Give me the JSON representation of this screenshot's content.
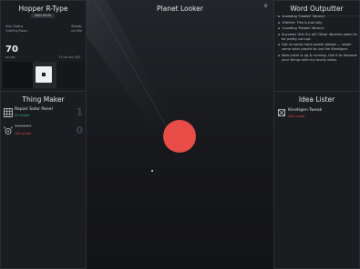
{
  "hopper": {
    "title": "Hopper R-Type",
    "subtitle": "0001.00.00",
    "rows": [
      {
        "label": "Ship Status",
        "value": "Steady"
      },
      {
        "label": "Orbiting Moon",
        "value": "no title"
      }
    ],
    "big_value": "70",
    "big_sub": "scrubs",
    "big_right": "13 ton ton 000"
  },
  "thing_maker": {
    "title": "Thing Maker",
    "items": [
      {
        "name": "Repair Solar Panel",
        "cost": "25 scrubs",
        "count": "1",
        "cost_color": "#38b883",
        "icon": "solar-panel-icon"
      },
      {
        "name": "********",
        "cost": "100 scrubs",
        "count": "0",
        "cost_color": "#e0484a",
        "icon": "satellite-icon"
      }
    ]
  },
  "planet_looker": {
    "title": "Planet Looker",
    "counter": "0",
    "planet_color": "#e84e47"
  },
  "word_outputter": {
    "title": "Word Outputter",
    "log": [
      "«Loading 'Cookie' library»",
      "«Failed» This is just silly.",
      "«Loading 'Potato' library»",
      "Success! Uhh it's ok? Other libraries seem to be pretty corrupt.",
      "Got us some more power please — repair some solar panels to use the Kinetigen.",
      "Idea Lister is up & running. Use it to improve your things with my lovely ideas."
    ]
  },
  "idea_lister": {
    "title": "Idea Lister",
    "items": [
      {
        "name": "Kinetigen Tweak",
        "cost": "200 scrubs",
        "cost_color": "#e0484a",
        "icon": "kinetigen-icon"
      }
    ]
  }
}
